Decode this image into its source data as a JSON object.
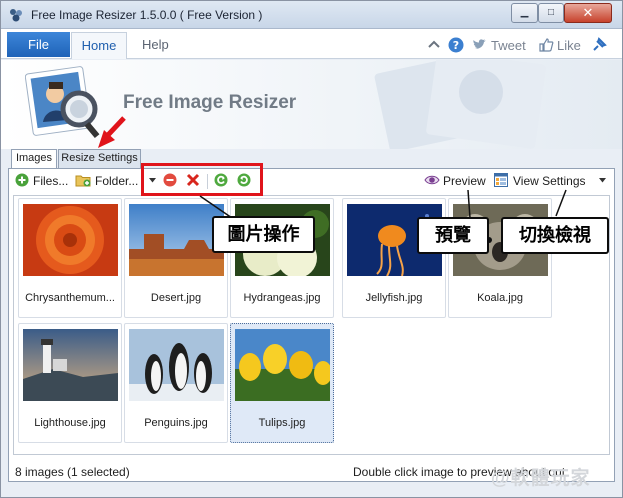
{
  "window": {
    "title": "Free Image Resizer 1.5.0.0 ( Free Version )",
    "controls": {
      "minimize": "▁",
      "maximize": "□",
      "close": "✕"
    }
  },
  "ribbon": {
    "file_tab": "File",
    "menus": [
      "Home",
      "Help"
    ],
    "tweet_label": "Tweet",
    "like_label": "Like"
  },
  "banner": {
    "title": "Free Image Resizer"
  },
  "panel_tabs": [
    "Images",
    "Resize Settings"
  ],
  "toolbar": {
    "files_label": "Files...",
    "folder_label": "Folder...",
    "preview_label": "Preview",
    "view_settings_label": "View Settings"
  },
  "images": [
    {
      "name": "Chrysanthemum...",
      "selected": false
    },
    {
      "name": "Desert.jpg",
      "selected": false
    },
    {
      "name": "Hydrangeas.jpg",
      "selected": false
    },
    {
      "name": "Jellyfish.jpg",
      "selected": false
    },
    {
      "name": "Koala.jpg",
      "selected": false
    },
    {
      "name": "Lighthouse.jpg",
      "selected": false
    },
    {
      "name": "Penguins.jpg",
      "selected": false
    },
    {
      "name": "Tulips.jpg",
      "selected": true
    }
  ],
  "status": {
    "count_text": "8 images (1 selected)",
    "hint_text": "Double click image to preview about out"
  },
  "annotations": {
    "image_ops": "圖片操作",
    "preview": "預覽",
    "switch_view": "切換檢視"
  },
  "watermark": "@軟體玩家",
  "colors": {
    "accent": "#1f63b8",
    "annotation_red": "#e0141b",
    "selection": "#dfe9f7"
  }
}
